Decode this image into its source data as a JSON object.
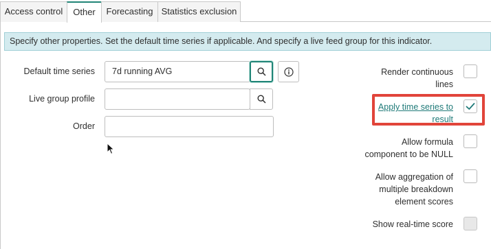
{
  "tabs": [
    {
      "label": "Access control",
      "active": false
    },
    {
      "label": "Other",
      "active": true
    },
    {
      "label": "Forecasting",
      "active": false
    },
    {
      "label": "Statistics exclusion",
      "active": false
    }
  ],
  "banner": {
    "text": "Specify other properties. Set the default time series if applicable. And specify a live feed group for this indicator."
  },
  "fields": {
    "default_time_series": {
      "label": "Default time series",
      "value": "7d running AVG"
    },
    "live_group_profile": {
      "label": "Live group profile",
      "value": ""
    },
    "order": {
      "label": "Order",
      "value": ""
    }
  },
  "options": {
    "render_continuous_lines": {
      "label_line1": "Render continuous",
      "label_line2": "lines",
      "checked": false
    },
    "apply_time_series": {
      "label_line1": "Apply time series to",
      "label_line2": "result",
      "checked": true
    },
    "allow_formula_null": {
      "label_line1": "Allow formula",
      "label_line2": "component to be NULL",
      "checked": false
    },
    "allow_aggregation": {
      "label_line1": "Allow aggregation of",
      "label_line2": "multiple breakdown",
      "label_line3": "element scores",
      "checked": false
    },
    "show_realtime_score": {
      "label": "Show real-time score",
      "checked": false,
      "disabled": true
    }
  },
  "colors": {
    "accent": "#1f8476",
    "highlight": "#e1443a",
    "banner_bg": "#d4ebef",
    "link": "#1f7a78"
  }
}
